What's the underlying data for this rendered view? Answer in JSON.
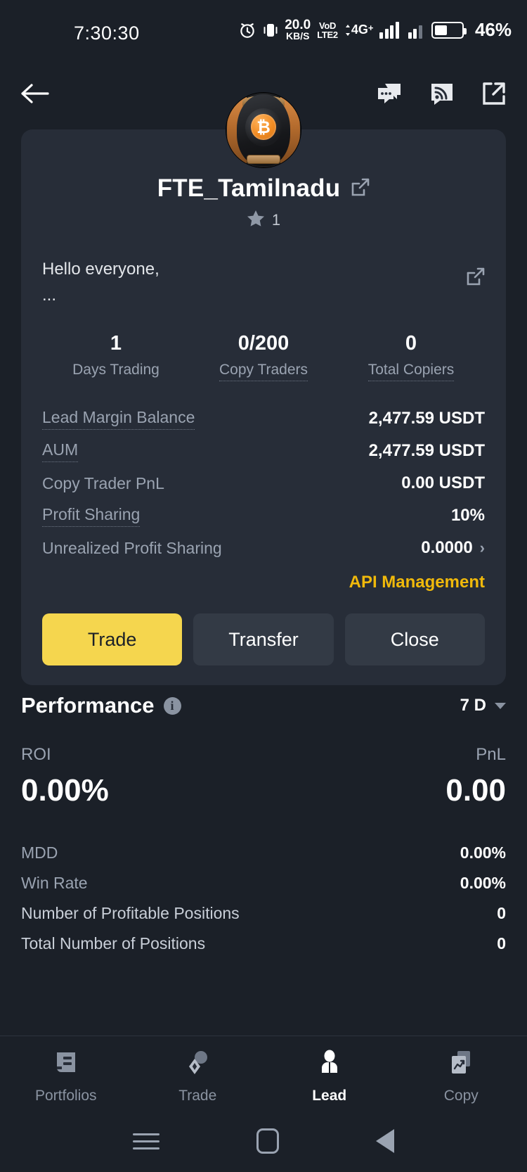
{
  "statusbar": {
    "time": "7:30:30",
    "net_speed_value": "20.0",
    "net_speed_unit": "KB/S",
    "volte_top": "VoD",
    "volte_bottom": "LTE2",
    "network": "4G",
    "network_plus": "+",
    "battery_percent": "46%",
    "icons": [
      "alarm-icon",
      "vibrate-icon",
      "volte-icon",
      "signal-icon",
      "battery-icon"
    ]
  },
  "header": {
    "back_icon": "back-arrow-icon",
    "actions": [
      "chat-icon",
      "feed-icon",
      "share-icon"
    ]
  },
  "profile": {
    "avatar_name": "bitcoin-avatar",
    "name": "FTE_Tamilnadu",
    "edit_icon": "edit-icon",
    "star_icon": "star-icon",
    "star_count": "1",
    "bio_line1": "Hello everyone,",
    "bio_line2": "...",
    "stats": [
      {
        "value": "1",
        "label": "Days Trading",
        "dotted": false
      },
      {
        "value": "0/200",
        "label": "Copy Traders",
        "dotted": true
      },
      {
        "value": "0",
        "label": "Total Copiers",
        "dotted": true
      }
    ],
    "rows": [
      {
        "label": "Lead Margin Balance",
        "value": "2,477.59 USDT",
        "dotted": true,
        "chevron": false
      },
      {
        "label": "AUM",
        "value": "2,477.59 USDT",
        "dotted": true,
        "chevron": false
      },
      {
        "label": "Copy Trader PnL",
        "value": "0.00 USDT",
        "dotted": false,
        "chevron": false
      },
      {
        "label": "Profit Sharing",
        "value": "10%",
        "dotted": true,
        "chevron": false
      },
      {
        "label": "Unrealized Profit Sharing",
        "value": "0.0000",
        "dotted": false,
        "chevron": true
      }
    ],
    "api_management": "API Management",
    "buttons": {
      "trade": "Trade",
      "transfer": "Transfer",
      "close": "Close"
    }
  },
  "performance": {
    "title": "Performance",
    "info_icon": "info-icon",
    "period": "7 D",
    "period_caret": "chevron-down-icon",
    "roi_label": "ROI",
    "pnl_label": "PnL",
    "roi_value": "0.00%",
    "pnl_value": "0.00",
    "metrics": [
      {
        "label": "MDD",
        "value": "0.00%"
      },
      {
        "label": "Win Rate",
        "value": "0.00%"
      },
      {
        "label": "Number of Profitable Positions",
        "value": "0"
      },
      {
        "label": "Total Number of Positions",
        "value": "0"
      }
    ]
  },
  "bottomnav": {
    "items": [
      {
        "label": "Portfolios",
        "icon": "portfolios-icon",
        "active": false
      },
      {
        "label": "Trade",
        "icon": "trade-icon",
        "active": false
      },
      {
        "label": "Lead",
        "icon": "lead-icon",
        "active": true
      },
      {
        "label": "Copy",
        "icon": "copy-icon",
        "active": false
      }
    ]
  },
  "androidbar": {
    "recents_icon": "recents-icon",
    "home_icon": "home-icon",
    "back_icon": "back-icon"
  },
  "colors": {
    "accent": "#f0b90b",
    "primary_button": "#f5d64e",
    "card": "#272d38",
    "background": "#1b2028"
  }
}
